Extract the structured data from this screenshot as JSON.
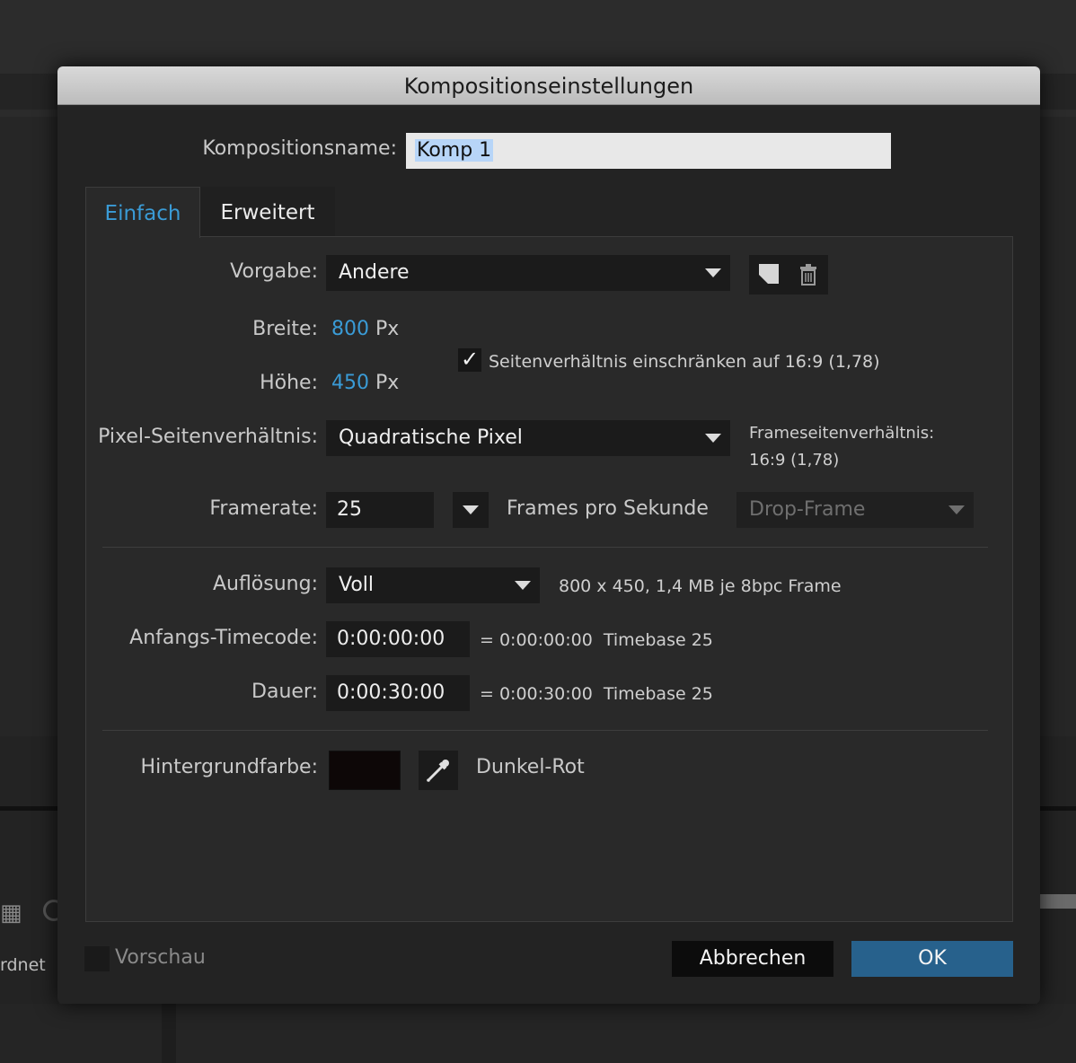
{
  "background": {
    "partial_label": "rdnet"
  },
  "dialog": {
    "title": "Kompositionseinstellungen",
    "name_label": "Kompositionsname:",
    "name_value": "Komp 1",
    "tabs": [
      {
        "label": "Einfach",
        "active": true
      },
      {
        "label": "Erweitert",
        "active": false
      }
    ],
    "preset_label": "Vorgabe:",
    "preset_value": "Andere",
    "width_label": "Breite:",
    "width_value": "800",
    "height_label": "Höhe:",
    "height_value": "450",
    "unit": "Px",
    "lock_aspect_label": "Seitenverhältnis einschränken auf 16:9 (1,78)",
    "lock_aspect_checked": true,
    "check_glyph": "✓",
    "pixel_aspect_label": "Pixel-Seitenverhältnis:",
    "pixel_aspect_value": "Quadratische Pixel",
    "frame_aspect_label": "Frameseitenverhältnis:",
    "frame_aspect_value": "16:9 (1,78)",
    "framerate_label": "Framerate:",
    "framerate_value": "25",
    "framerate_unit": "Frames pro Sekunde",
    "dropframe_value": "Drop-Frame",
    "resolution_label": "Auflösung:",
    "resolution_value": "Voll",
    "resolution_info": "800 x 450, 1,4 MB je 8bpc Frame",
    "start_tc_label": "Anfangs-Timecode:",
    "start_tc_value": "0:00:00:00",
    "start_tc_info": "= 0:00:00:00  Timebase 25",
    "duration_label": "Dauer:",
    "duration_value": "0:00:30:00",
    "duration_info": "= 0:00:30:00  Timebase 25",
    "bgcolor_label": "Hintergrundfarbe:",
    "bgcolor_name": "Dunkel-Rot",
    "preview_label": "Vorschau",
    "cancel_label": "Abbrechen",
    "ok_label": "OK"
  },
  "colors": {
    "accent": "#3a9bd6",
    "ok_button": "#27618c",
    "swatch": "#0d0707"
  },
  "icons": [
    "save-preset-icon",
    "trash-icon",
    "eyedropper-icon",
    "checkbox-icon",
    "dropdown-caret-icon"
  ]
}
